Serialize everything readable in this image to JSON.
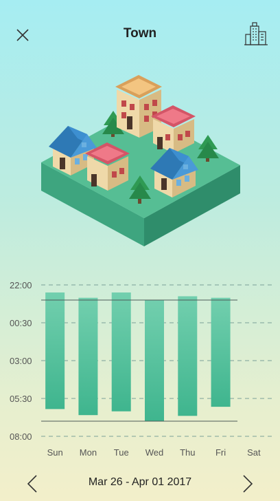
{
  "header": {
    "title": "Town",
    "close_icon": "close-icon",
    "city_icon": "buildings-icon"
  },
  "chart_data": {
    "type": "bar",
    "categories": [
      "Sun",
      "Mon",
      "Tue",
      "Wed",
      "Thu",
      "Fri",
      "Sat"
    ],
    "y_ticks": [
      "22:00",
      "00:30",
      "03:00",
      "05:30",
      "08:00"
    ],
    "y_tick_hours": [
      22,
      24.5,
      27,
      29.5,
      32
    ],
    "ylim_hours": [
      22,
      32
    ],
    "series": [
      {
        "start_hours": [
          22.5,
          22.85,
          22.5,
          23.0,
          22.75,
          22.85,
          null
        ],
        "end_hours": [
          30.2,
          30.6,
          30.35,
          31.0,
          30.65,
          30.05,
          null
        ]
      }
    ],
    "reference_lines_hours": [
      23.0,
      31.0
    ],
    "grid": "dashed",
    "colors": {
      "bar_top": "#72cfae",
      "bar_bottom": "#3fb58e",
      "text": "#555555"
    }
  },
  "footer": {
    "date_range": "Mar 26 - Apr 01 2017",
    "prev_icon": "chevron-left-icon",
    "next_icon": "chevron-right-icon"
  }
}
